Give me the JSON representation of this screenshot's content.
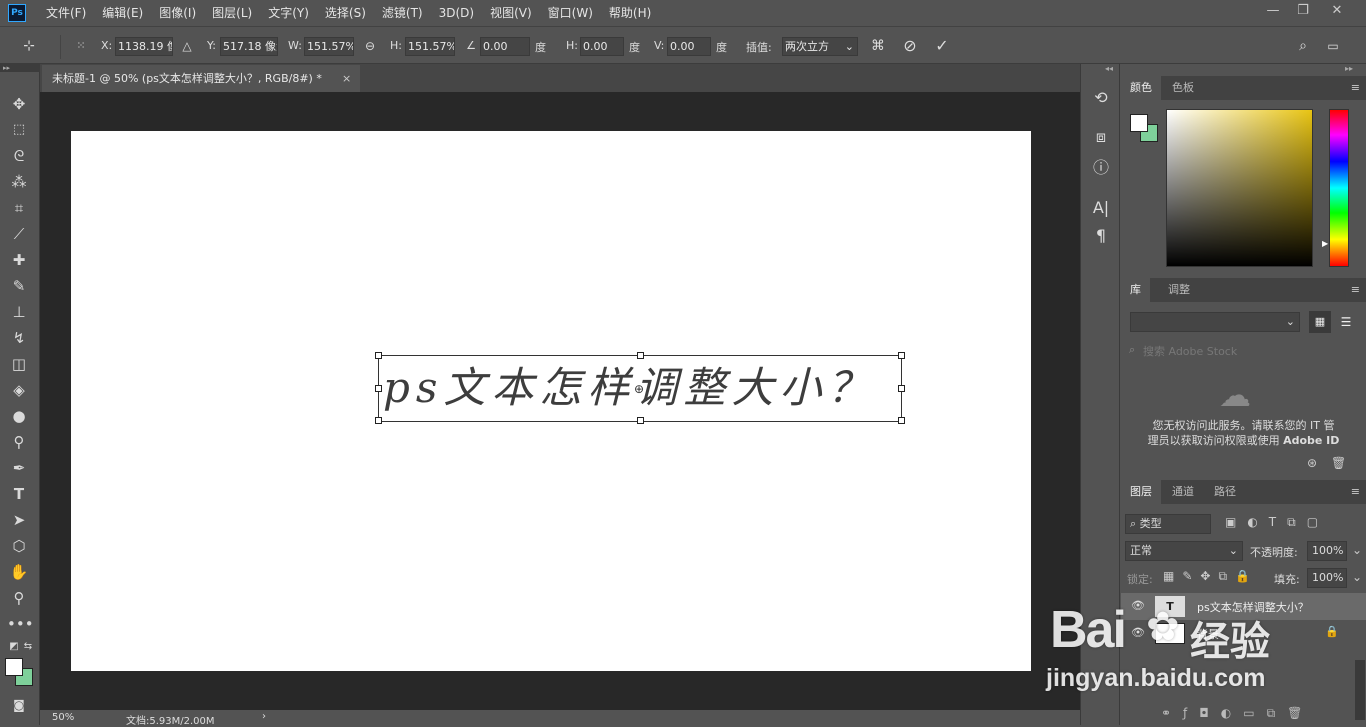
{
  "app": {
    "logo": "Ps"
  },
  "menu": [
    "文件(F)",
    "编辑(E)",
    "图像(I)",
    "图层(L)",
    "文字(Y)",
    "选择(S)",
    "滤镜(T)",
    "3D(D)",
    "视图(V)",
    "窗口(W)",
    "帮助(H)"
  ],
  "window_controls": {
    "minimize": "—",
    "restore": "❐",
    "close": "✕"
  },
  "options": {
    "x_label": "X:",
    "x_value": "1138.19 像",
    "y_label": "Y:",
    "y_value": "517.18 像素",
    "w_label": "W:",
    "w_value": "151.57%",
    "h_label": "H:",
    "h_value": "151.57%",
    "angle_value": "0.00",
    "angle_unit": "度",
    "hskew_label": "H:",
    "hskew_value": "0.00",
    "hskew_unit": "度",
    "vskew_label": "V:",
    "vskew_value": "0.00",
    "vskew_unit": "度",
    "interp_label": "插值:",
    "interp_value": "两次立方"
  },
  "document": {
    "tab_title": "未标题-1 @ 50% (ps文本怎样调整大小？, RGB/8#) *",
    "tab_close": "×",
    "canvas_text": "ps文本怎样调整大小？"
  },
  "status": {
    "zoom": "50%",
    "doc_info": "文档:5.93M/2.00M",
    "arrow": "›"
  },
  "panels": {
    "color_tabs": [
      "颜色",
      "色板"
    ],
    "library_tabs": [
      "库",
      "调整"
    ],
    "library_search_placeholder": "搜索 Adobe Stock",
    "library_message_line1": "您无权访问此服务。请联系您的 IT 管",
    "library_message_line2": "理员以获取访问权限或使用",
    "library_message_bold": "Adobe ID",
    "layers_tabs": [
      "图层",
      "通道",
      "路径"
    ],
    "layer_filter": "类型",
    "blend_mode": "正常",
    "opacity_label": "不透明度:",
    "opacity_value": "100%",
    "lock_label": "锁定:",
    "fill_label": "填充:",
    "fill_value": "100%",
    "layers": [
      {
        "name": "ps文本怎样调整大小？",
        "kind": "T"
      },
      {
        "name": "背景",
        "kind": "bg"
      }
    ]
  },
  "watermark": {
    "brand": "Bai",
    "brand2": "经验",
    "url": "jingyan.baidu.com"
  },
  "colors": {
    "accent": "#31a8ff",
    "background_swatch": "#7ed09a",
    "annotation_arrow": "#e8332b"
  }
}
